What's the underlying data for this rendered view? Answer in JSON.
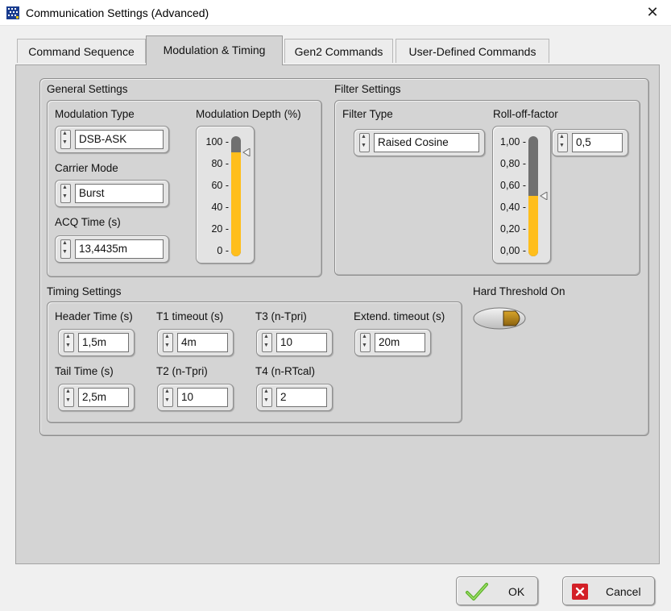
{
  "window": {
    "title": "Communication Settings (Advanced)",
    "close_glyph": "✕"
  },
  "tabs": [
    {
      "label": "Command Sequence",
      "active": false
    },
    {
      "label": "Modulation & Timing",
      "active": true
    },
    {
      "label": "Gen2 Commands",
      "active": false
    },
    {
      "label": "User-Defined Commands",
      "active": false
    }
  ],
  "general": {
    "label": "General Settings",
    "modulation_type": {
      "label": "Modulation Type",
      "value": "DSB-ASK"
    },
    "carrier_mode": {
      "label": "Carrier Mode",
      "value": "Burst"
    },
    "acq_time": {
      "label": "ACQ Time (s)",
      "value": "13,4435m"
    },
    "modulation_depth": {
      "label": "Modulation Depth (%)",
      "ticks": [
        "100 -",
        "80 -",
        "60 -",
        "40 -",
        "20 -",
        "0 -"
      ],
      "value_percent": 90
    }
  },
  "filter": {
    "label": "Filter Settings",
    "filter_type": {
      "label": "Filter Type",
      "value": "Raised Cosine"
    },
    "rolloff": {
      "label": "Roll-off-factor",
      "value": "0,5",
      "ticks": [
        "1,00 -",
        "0,80 -",
        "0,60 -",
        "0,40 -",
        "0,20 -",
        "0,00 -"
      ],
      "value_fraction": 0.5
    }
  },
  "timing": {
    "label": "Timing Settings",
    "header_time": {
      "label": "Header Time (s)",
      "value": "1,5m"
    },
    "t1_timeout": {
      "label": "T1 timeout (s)",
      "value": "4m"
    },
    "t3": {
      "label": "T3 (n-Tpri)",
      "value": "10"
    },
    "extend_timeout": {
      "label": "Extend. timeout (s)",
      "value": "20m"
    },
    "tail_time": {
      "label": "Tail Time (s)",
      "value": "2,5m"
    },
    "t2": {
      "label": "T2 (n-Tpri)",
      "value": "10"
    },
    "t4": {
      "label": "T4 (n-RTcal)",
      "value": "2"
    }
  },
  "hard_threshold": {
    "label": "Hard Threshold On",
    "on": true
  },
  "buttons": {
    "ok": "OK",
    "cancel": "Cancel"
  },
  "colors": {
    "fill": "#ffbe1c",
    "track": "#707070",
    "panel": "#d4d4d4",
    "ok_check": "#5db12a",
    "cancel_red": "#d32027"
  }
}
